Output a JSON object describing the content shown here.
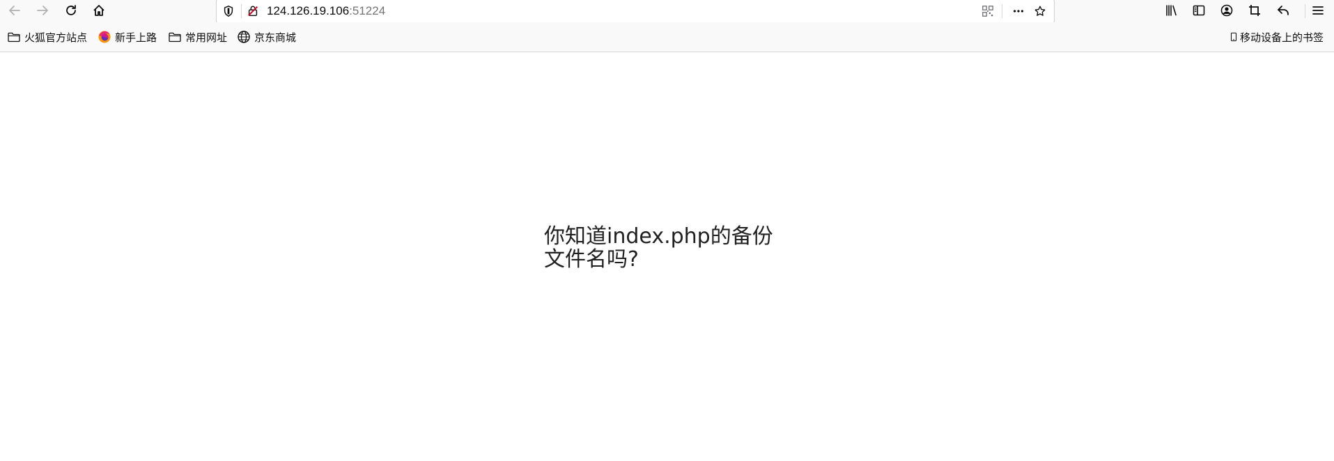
{
  "browser": {
    "url_host": "124.126.19.106",
    "url_port": ":51224",
    "nav_icons": [
      "back-arrow-icon",
      "forward-arrow-icon",
      "reload-icon",
      "home-icon"
    ],
    "right_icons": [
      "library-icon",
      "sidebar-icon",
      "account-icon",
      "screenshot-icon",
      "undo-icon",
      "menu-icon"
    ]
  },
  "bookmarks": {
    "items": [
      {
        "label": "火狐官方站点",
        "icon": "folder-icon"
      },
      {
        "label": "新手上路",
        "icon": "firefox-icon"
      },
      {
        "label": "常用网址",
        "icon": "folder-icon"
      },
      {
        "label": "京东商城",
        "icon": "globe-icon"
      }
    ],
    "mobile_label": "移动设备上的书签"
  },
  "page": {
    "message": "你知道index.php的备份文件名吗?"
  },
  "colors": {
    "toolbar_bg": "#f9f9fa",
    "insecure_red": "#d70022",
    "text": "#202020"
  }
}
